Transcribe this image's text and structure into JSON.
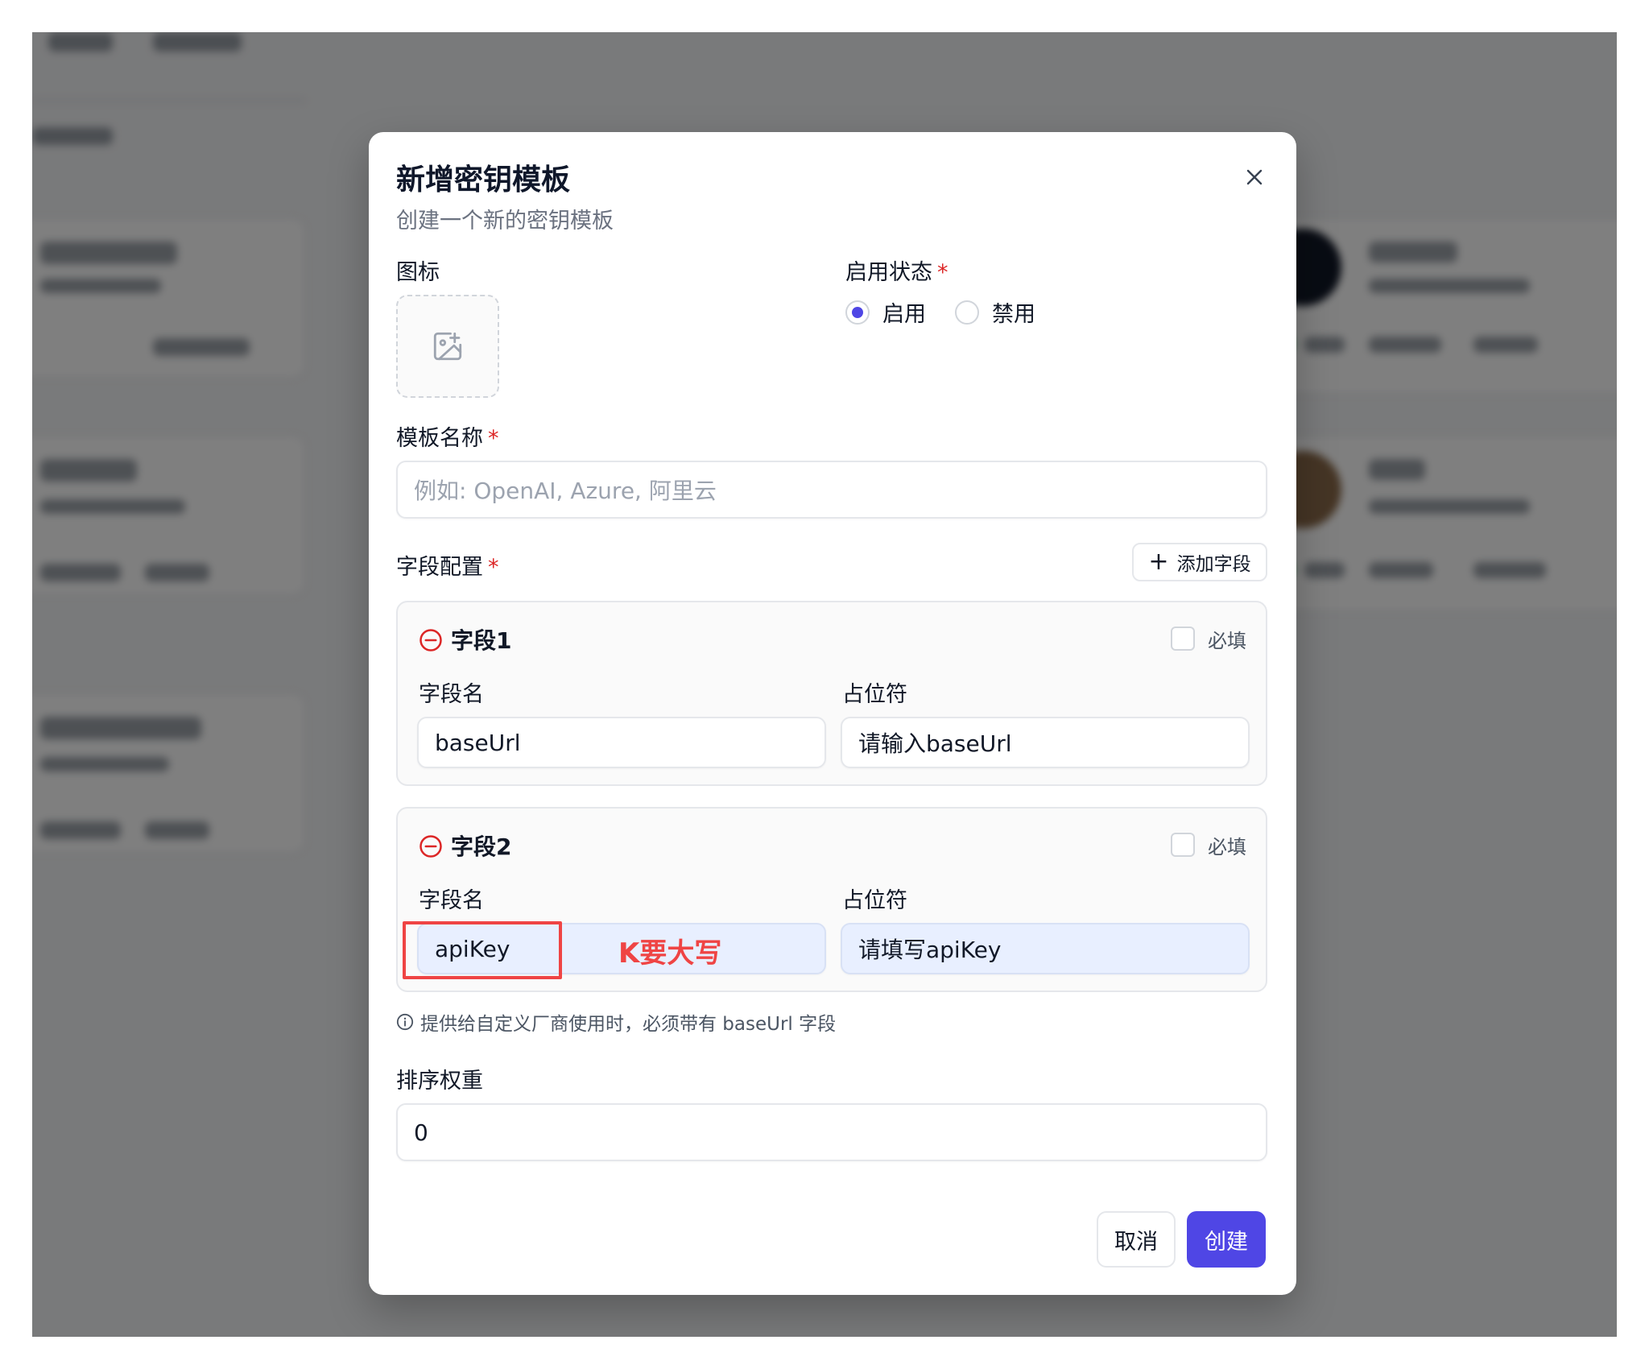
{
  "modal": {
    "title": "新增密钥模板",
    "subtitle": "创建一个新的密钥模板",
    "close_icon": "close-icon"
  },
  "form": {
    "icon_label": "图标",
    "icon_placeholder_icon": "image-add-icon",
    "status_label": "启用状态",
    "status_options": [
      {
        "label": "启用",
        "selected": true
      },
      {
        "label": "禁用",
        "selected": false
      }
    ],
    "name_label": "模板名称",
    "name_placeholder": "例如: OpenAI, Azure, 阿里云",
    "fields_label": "字段配置",
    "add_field_label": "添加字段",
    "required_marker": "*",
    "fields": [
      {
        "title": "字段1",
        "required_label": "必填",
        "required": false,
        "name_label": "字段名",
        "name_value": "baseUrl",
        "placeholder_label": "占位符",
        "placeholder_value": "请输入baseUrl"
      },
      {
        "title": "字段2",
        "required_label": "必填",
        "required": false,
        "name_label": "字段名",
        "name_value": "apiKey",
        "placeholder_label": "占位符",
        "placeholder_value": "请填写apiKey"
      }
    ],
    "hint": "提供给自定义厂商使用时，必须带有 baseUrl 字段",
    "sort_label": "排序权重",
    "sort_value": "0"
  },
  "actions": {
    "cancel": "取消",
    "create": "创建"
  },
  "annotation": {
    "text": "K要大写",
    "color": "#ef4444"
  },
  "colors": {
    "primary": "#4f46e5",
    "required": "#dc2626",
    "overlay": "rgba(0,0,0,0.5)"
  }
}
